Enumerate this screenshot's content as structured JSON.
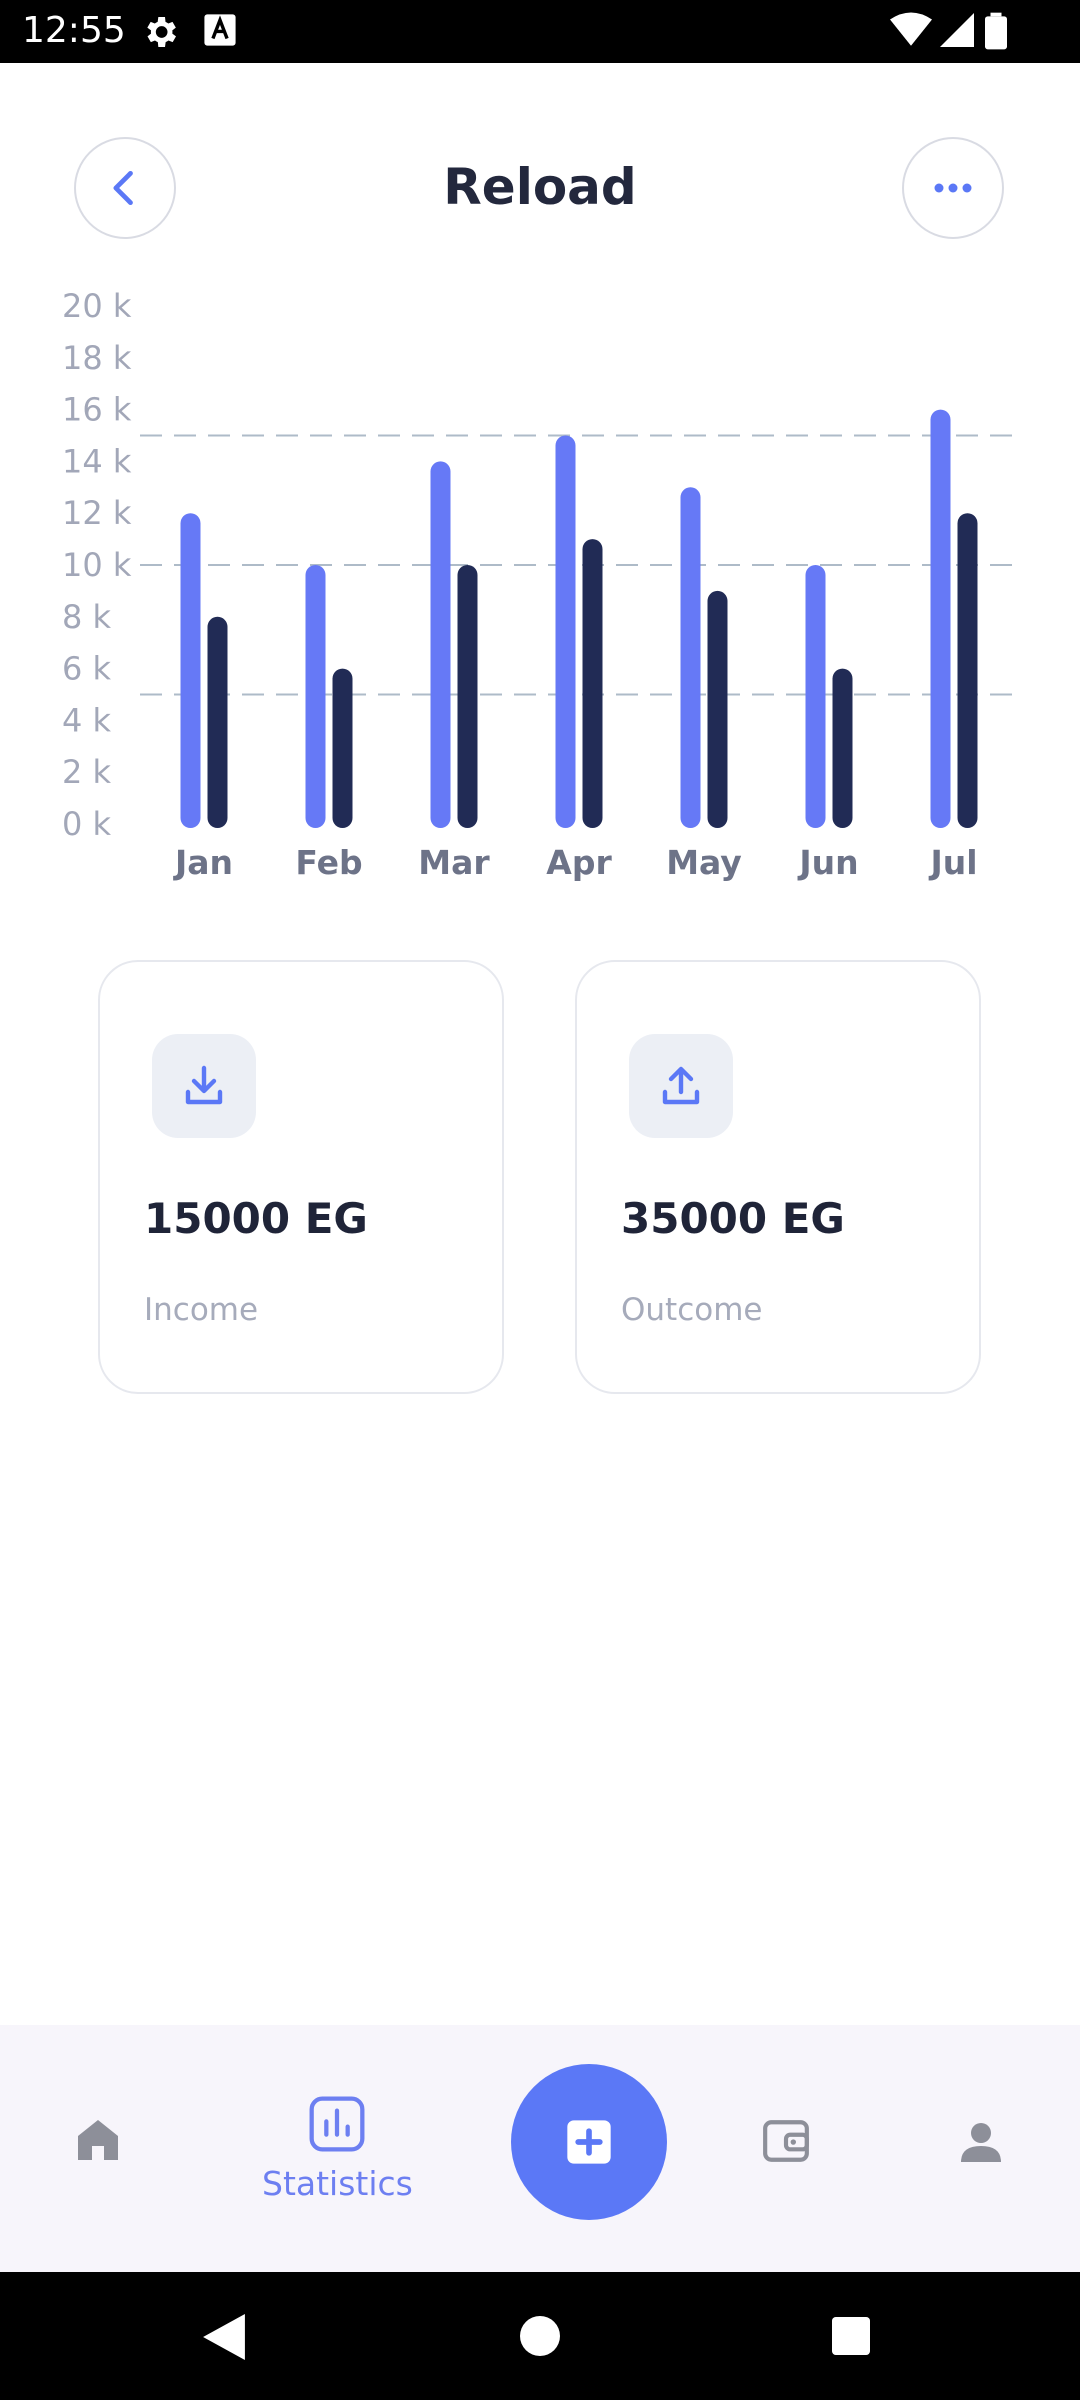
{
  "status_bar": {
    "time": "12:55",
    "icons": [
      "settings-icon",
      "keyboard-a-icon",
      "wifi-icon",
      "signal-icon",
      "battery-icon"
    ]
  },
  "header": {
    "title": "Reload",
    "back_icon": "chevron-left-icon",
    "more_icon": "more-dots-icon"
  },
  "chart_data": {
    "type": "bar",
    "categories": [
      "Jan",
      "Feb",
      "Mar",
      "Apr",
      "May",
      "Jun",
      "Jul"
    ],
    "series": [
      {
        "values": [
          12000,
          10000,
          14000,
          15000,
          13000,
          10000,
          16000
        ],
        "color": "#6679f6"
      },
      {
        "values": [
          8000,
          6000,
          10000,
          11000,
          9000,
          6000,
          12000
        ],
        "color": "#212b55"
      }
    ],
    "y_ticks": [
      "0 k",
      "2 k",
      "4 k",
      "6 k",
      "8 k",
      "10 k",
      "12 k",
      "14 k",
      "16 k",
      "18 k",
      "20 k"
    ],
    "ylim": [
      0,
      20000
    ],
    "gridlines": [
      5000,
      10000,
      15000
    ],
    "grid": "dashed",
    "legend": "none"
  },
  "cards": [
    {
      "amount": "15000 EG",
      "label": "Income",
      "icon": "download-icon"
    },
    {
      "amount": "35000 EG",
      "label": "Outcome",
      "icon": "upload-icon"
    }
  ],
  "bottom_nav": {
    "items": [
      {
        "icon": "home-icon",
        "label": ""
      },
      {
        "icon": "statistics-icon",
        "label": "Statistics",
        "active": true
      },
      {
        "icon": "add-icon",
        "label": ""
      },
      {
        "icon": "wallet-icon",
        "label": ""
      },
      {
        "icon": "profile-icon",
        "label": ""
      }
    ]
  },
  "colors": {
    "accent": "#5b78f6",
    "dark_bar": "#212b55",
    "title": "#23283d"
  }
}
